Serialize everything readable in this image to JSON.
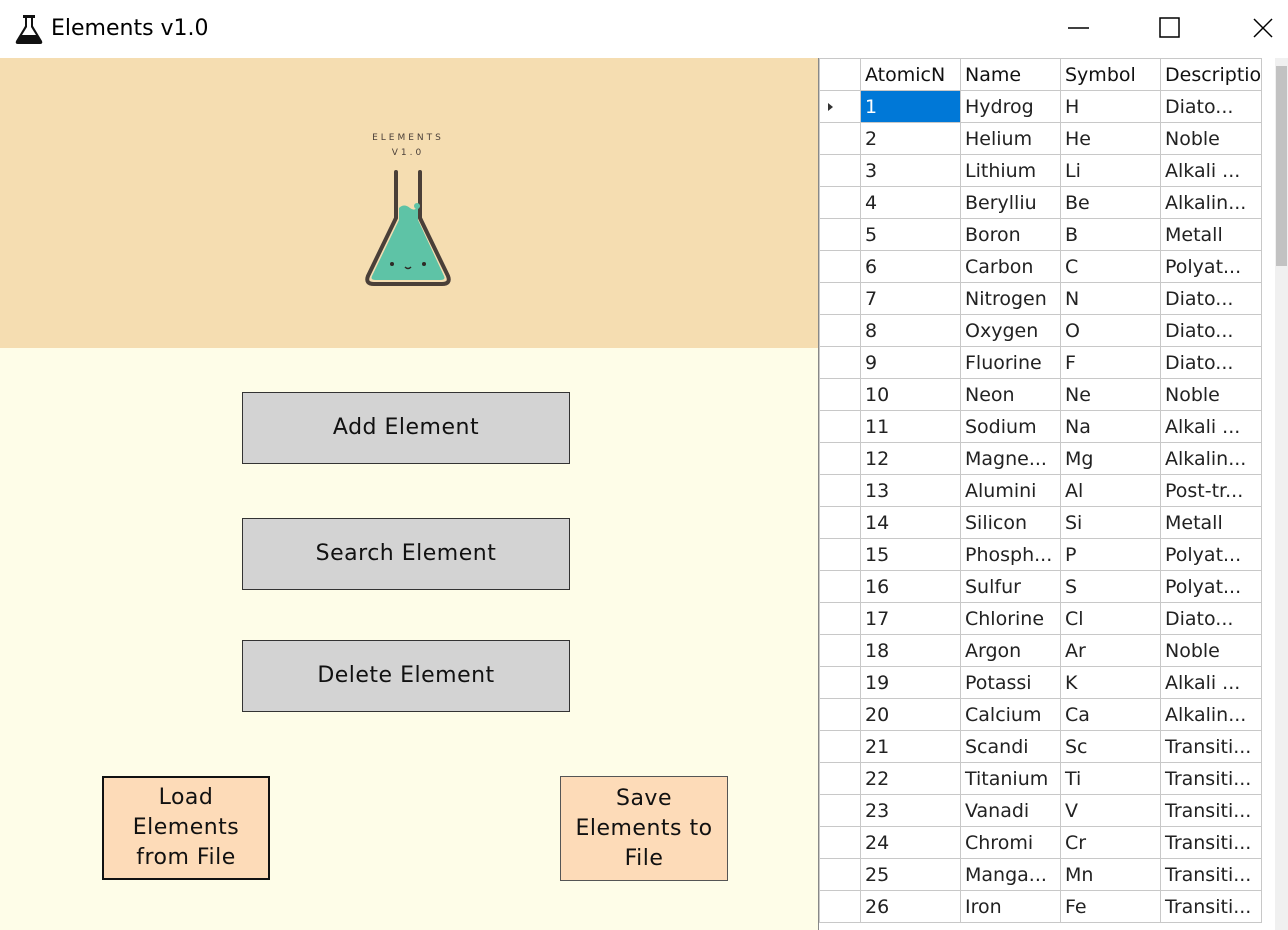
{
  "window": {
    "title": "Elements v1.0",
    "icon": "flask-icon"
  },
  "logo": {
    "line1": "ELEMENTS",
    "line2": "V1.0",
    "colors": {
      "background": "#f5ddb1",
      "liquid": "#5ec3a6",
      "glass": "#4a3f38"
    }
  },
  "actions": {
    "add_label": "Add Element",
    "search_label": "Search Element",
    "delete_label": "Delete Element",
    "load_label": "Load\nElements\nfrom File",
    "save_label": "Save\nElements to\nFile"
  },
  "grid": {
    "columns": [
      "AtomicN",
      "Name",
      "Symbol",
      "Descriptio"
    ],
    "selected_row": 0,
    "rows": [
      [
        "1",
        "Hydrog",
        "H",
        "Diato..."
      ],
      [
        "2",
        "Helium",
        "He",
        "Noble"
      ],
      [
        "3",
        "Lithium",
        "Li",
        "Alkali ..."
      ],
      [
        "4",
        "Berylliu",
        "Be",
        "Alkalin..."
      ],
      [
        "5",
        "Boron",
        "B",
        "Metall"
      ],
      [
        "6",
        "Carbon",
        "C",
        "Polyat..."
      ],
      [
        "7",
        "Nitrogen",
        "N",
        "Diato..."
      ],
      [
        "8",
        "Oxygen",
        "O",
        "Diato..."
      ],
      [
        "9",
        "Fluorine",
        "F",
        "Diato..."
      ],
      [
        "10",
        "Neon",
        "Ne",
        "Noble"
      ],
      [
        "11",
        "Sodium",
        "Na",
        "Alkali ..."
      ],
      [
        "12",
        "Magne...",
        "Mg",
        "Alkalin..."
      ],
      [
        "13",
        "Alumini",
        "Al",
        "Post-tr..."
      ],
      [
        "14",
        "Silicon",
        "Si",
        "Metall"
      ],
      [
        "15",
        "Phosph...",
        "P",
        "Polyat..."
      ],
      [
        "16",
        "Sulfur",
        "S",
        "Polyat..."
      ],
      [
        "17",
        "Chlorine",
        "Cl",
        "Diato..."
      ],
      [
        "18",
        "Argon",
        "Ar",
        "Noble"
      ],
      [
        "19",
        "Potassi",
        "K",
        "Alkali ..."
      ],
      [
        "20",
        "Calcium",
        "Ca",
        "Alkalin..."
      ],
      [
        "21",
        "Scandi",
        "Sc",
        "Transiti..."
      ],
      [
        "22",
        "Titanium",
        "Ti",
        "Transiti..."
      ],
      [
        "23",
        "Vanadi",
        "V",
        "Transiti..."
      ],
      [
        "24",
        "Chromi",
        "Cr",
        "Transiti..."
      ],
      [
        "25",
        "Manga...",
        "Mn",
        "Transiti..."
      ],
      [
        "26",
        "Iron",
        "Fe",
        "Transiti..."
      ]
    ]
  }
}
